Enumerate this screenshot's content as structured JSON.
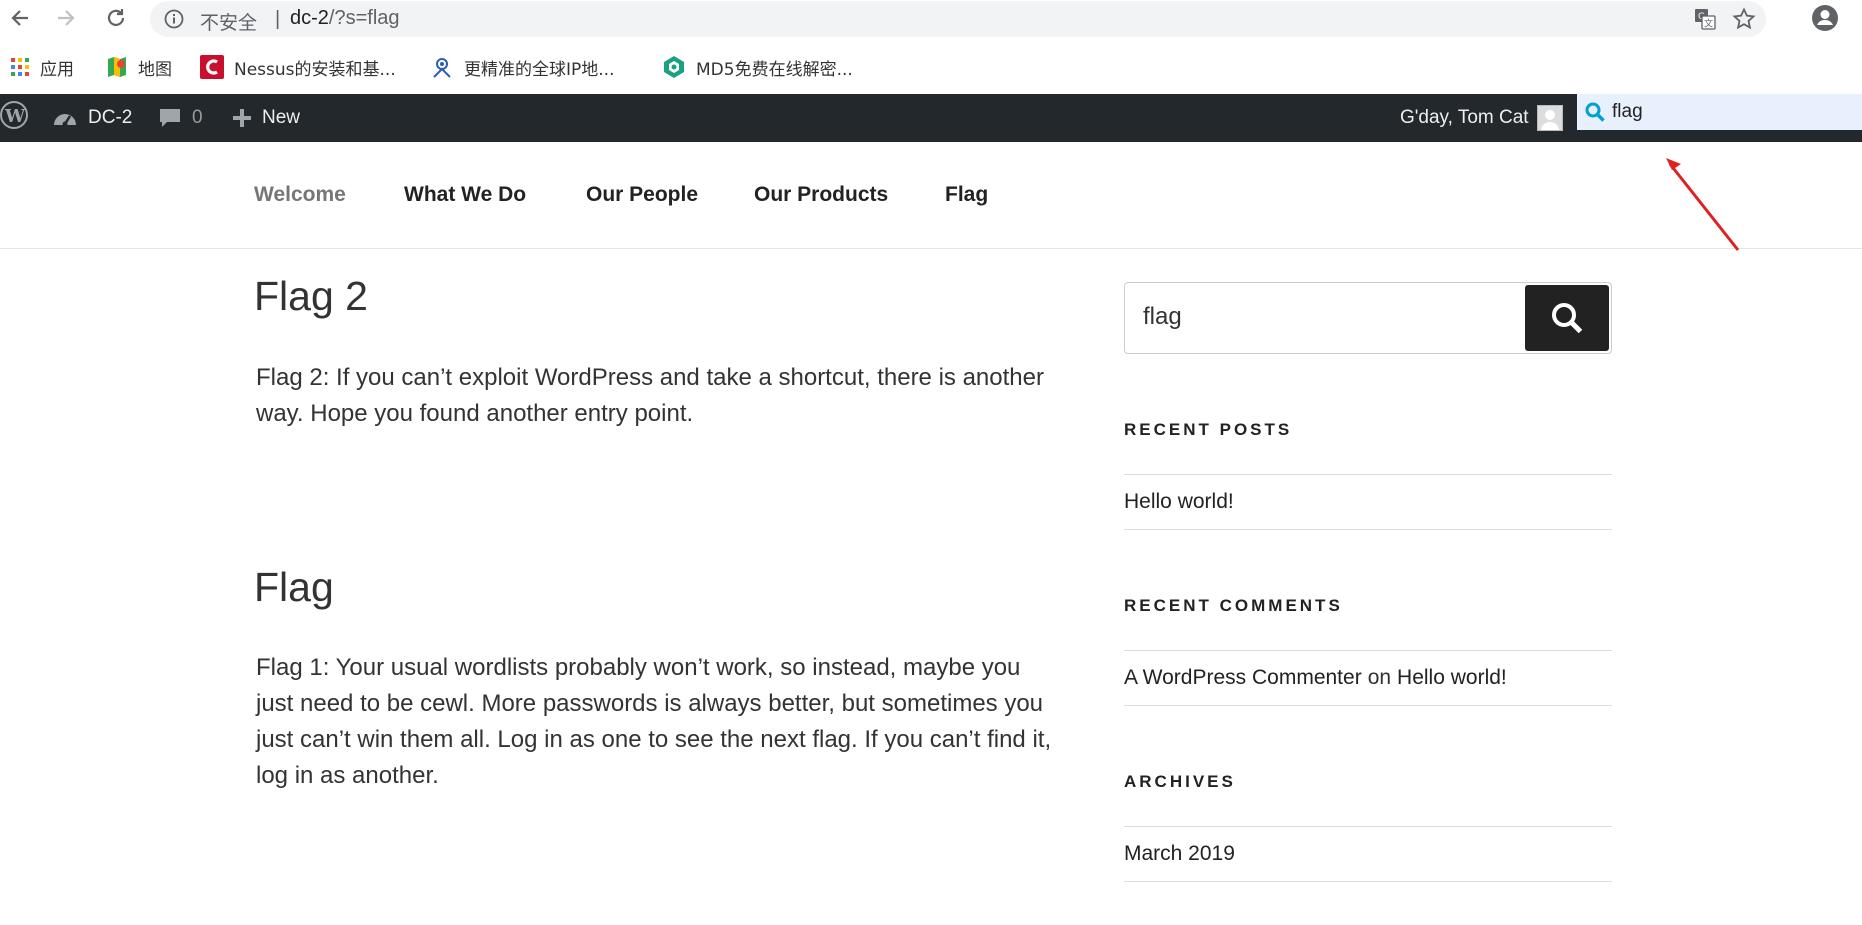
{
  "browser": {
    "insecure_label": "不安全",
    "separator": "|",
    "url_host": "dc-2",
    "url_path": "/?s=flag",
    "bookmarks": [
      {
        "label": "应用",
        "icon": "apps-grid-icon"
      },
      {
        "label": "地图",
        "icon": "maps-icon"
      },
      {
        "label": "Nessus的安装和基...",
        "icon": "bookmark-c-icon"
      },
      {
        "label": "更精准的全球IP地...",
        "icon": "ip-locator-icon"
      },
      {
        "label": "MD5免费在线解密...",
        "icon": "md5-icon"
      }
    ]
  },
  "adminbar": {
    "site_name": "DC-2",
    "comments_count": "0",
    "new_label": "New",
    "greeting": "G'day, Tom Cat",
    "search_value": "flag"
  },
  "nav": {
    "items": [
      "Welcome",
      "What We Do",
      "Our People",
      "Our Products",
      "Flag"
    ]
  },
  "posts": [
    {
      "title": "Flag 2",
      "body": "Flag 2: If you can’t exploit WordPress and take a shortcut, there is another way. Hope you found another entry point."
    },
    {
      "title": "Flag",
      "body": "Flag 1: Your usual wordlists probably won’t work, so instead, maybe you just need to be cewl. More passwords is always better, but sometimes you just can’t win them all. Log in as one to see the next flag. If you can’t find it, log in as another."
    }
  ],
  "sidebar": {
    "search_value": "flag",
    "recent_posts_title": "RECENT POSTS",
    "recent_posts": [
      "Hello world!"
    ],
    "recent_comments_title": "RECENT COMMENTS",
    "recent_comment": {
      "author": "A WordPress Commenter",
      "on": "on",
      "post": "Hello world!"
    },
    "archives_title": "ARCHIVES",
    "archives": [
      "March 2019"
    ]
  },
  "colors": {
    "adminbar_bg": "#23282d",
    "annotation_arrow": "#e02020"
  }
}
